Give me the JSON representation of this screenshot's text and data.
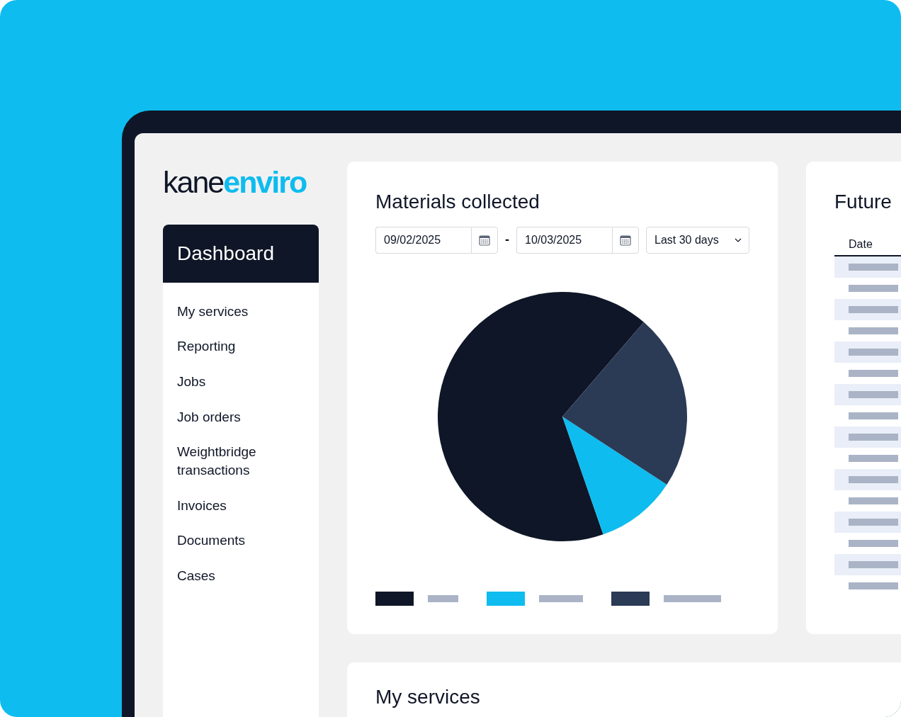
{
  "logo": {
    "first": "kane",
    "second": "enviro"
  },
  "sidebar": {
    "items": [
      {
        "label": "Dashboard",
        "selected": true
      },
      {
        "label": "My services",
        "selected": false
      },
      {
        "label": "Reporting",
        "selected": false
      },
      {
        "label": "Jobs",
        "selected": false
      },
      {
        "label": "Job orders",
        "selected": false
      },
      {
        "label": "Weightbridge transactions",
        "selected": false
      },
      {
        "label": "Invoices",
        "selected": false
      },
      {
        "label": "Documents",
        "selected": false
      },
      {
        "label": "Cases",
        "selected": false
      }
    ]
  },
  "materials": {
    "title": "Materials collected",
    "from_date": "09/02/2025",
    "separator": "-",
    "to_date": "10/03/2025",
    "range": "Last 30 days",
    "legend": [
      {
        "color": "#0f1627"
      },
      {
        "color": "#0ebcef"
      },
      {
        "color": "#2b3a55"
      }
    ]
  },
  "future": {
    "title": "Future",
    "columns": [
      "Date"
    ]
  },
  "services": {
    "title": "My services"
  }
}
